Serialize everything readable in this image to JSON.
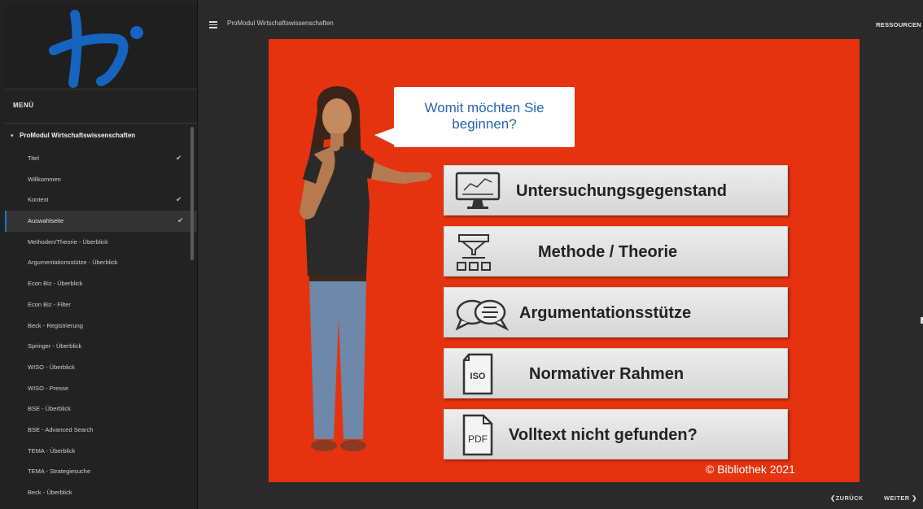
{
  "app": {
    "logo": "th-logo",
    "accent": "#1a75c7",
    "slide_bg": "#e5330f"
  },
  "sidebar": {
    "menu_title": "MENÜ",
    "section_label": "ProModul Wirtschaftswissenschaften",
    "items": [
      {
        "label": "Titel",
        "done": "✔"
      },
      {
        "label": "Willkommen",
        "done": ""
      },
      {
        "label": "Kontext",
        "done": "✔"
      },
      {
        "label": "Auswahlseite",
        "done": "✔"
      },
      {
        "label": "Methoden/Theorie - Überblick",
        "done": ""
      },
      {
        "label": "Argumentationsstütze - Überblick",
        "done": ""
      },
      {
        "label": "Econ Biz - Überblick",
        "done": ""
      },
      {
        "label": "Econ Biz - Filter",
        "done": ""
      },
      {
        "label": "Beck - Registrierung",
        "done": ""
      },
      {
        "label": "Springer - Überblick",
        "done": ""
      },
      {
        "label": "WISO - Überblick",
        "done": ""
      },
      {
        "label": "WISO - Presse",
        "done": ""
      },
      {
        "label": "BSE - Überblick",
        "done": ""
      },
      {
        "label": "BSE - Advanced Search",
        "done": ""
      },
      {
        "label": "TEMA - Überblick",
        "done": ""
      },
      {
        "label": "TEMA - Strategiesuche",
        "done": ""
      },
      {
        "label": "Beck - Überblick",
        "done": ""
      }
    ]
  },
  "header": {
    "course_title": "ProModul Wirtschaftswissenschaften",
    "resources": "RESSOURCEN"
  },
  "slide": {
    "question_line1": "Womit möchten Sie",
    "question_line2": "beginnen?",
    "options": [
      {
        "label": "Untersuchungsgegenstand",
        "icon": "monitor-chart-icon"
      },
      {
        "label": "Methode / Theorie",
        "icon": "funnel-boxes-icon"
      },
      {
        "label": "Argumentationsstütze",
        "icon": "speech-bubbles-icon"
      },
      {
        "label": "Normativer Rahmen",
        "icon": "iso-document-icon"
      },
      {
        "label": "Volltext nicht gefunden?",
        "icon": "pdf-document-icon"
      }
    ],
    "iso_text": "ISO",
    "pdf_text": "PDF",
    "copyright": "© Bibliothek 2021"
  },
  "nav": {
    "back": "ZURÜCK",
    "next": "WEITER"
  }
}
